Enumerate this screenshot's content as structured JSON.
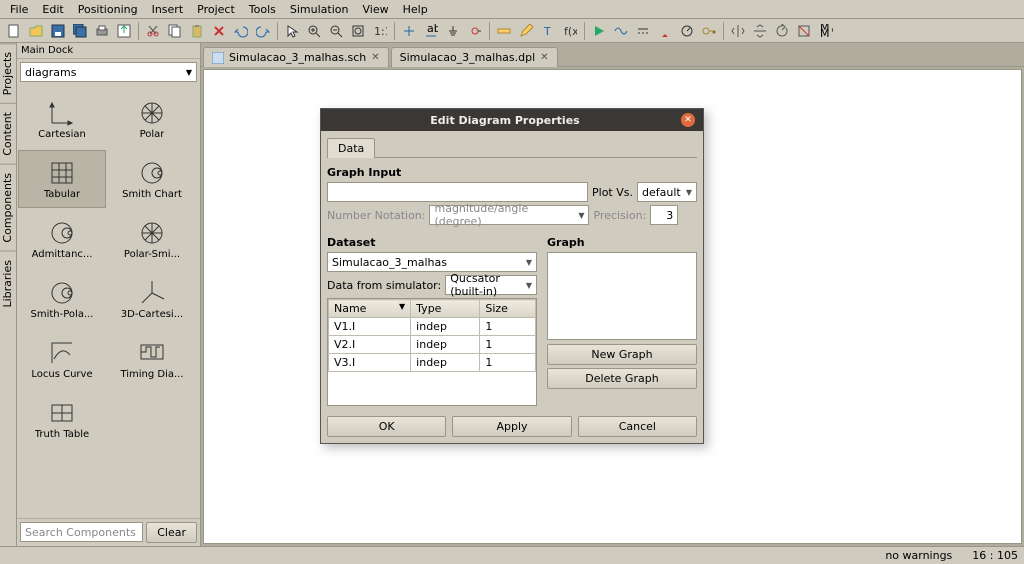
{
  "menu": [
    "File",
    "Edit",
    "Positioning",
    "Insert",
    "Project",
    "Tools",
    "Simulation",
    "View",
    "Help"
  ],
  "dock": {
    "title": "Main Dock",
    "combo": "diagrams",
    "items": [
      {
        "label": "Cartesian",
        "icon": "axes"
      },
      {
        "label": "Polar",
        "icon": "polar"
      },
      {
        "label": "Tabular",
        "icon": "tabular",
        "selected": true
      },
      {
        "label": "Smith Chart",
        "icon": "smith"
      },
      {
        "label": "Admittanc...",
        "icon": "smith"
      },
      {
        "label": "Polar-Smi...",
        "icon": "polar"
      },
      {
        "label": "Smith-Pola...",
        "icon": "smith"
      },
      {
        "label": "3D-Cartesi...",
        "icon": "3d"
      },
      {
        "label": "Locus Curve",
        "icon": "locus"
      },
      {
        "label": "Timing Dia...",
        "icon": "timing"
      },
      {
        "label": "Truth Table",
        "icon": "table"
      }
    ],
    "search_placeholder": "Search Components",
    "clear": "Clear"
  },
  "sidetabs": [
    "Projects",
    "Content",
    "Components",
    "Libraries"
  ],
  "docs": [
    {
      "label": "Simulacao_3_malhas.sch"
    },
    {
      "label": "Simulacao_3_malhas.dpl"
    }
  ],
  "status": {
    "warnings": "no warnings",
    "pos": "16 : 105"
  },
  "dialog": {
    "title": "Edit Diagram Properties",
    "tab": "Data",
    "graph_input_label": "Graph Input",
    "plot_vs": "Plot Vs.",
    "plot_vs_value": "default",
    "nn_label": "Number Notation:",
    "nn_value": "magnitude/angle (degree)",
    "precision_label": "Precision:",
    "precision_value": "3",
    "dataset_label": "Dataset",
    "dataset_value": "Simulacao_3_malhas",
    "dfs_label": "Data from simulator:",
    "dfs_value": "Qucsator (built-in)",
    "cols": [
      "Name",
      "Type",
      "Size"
    ],
    "rows": [
      {
        "name": "V1.I",
        "type": "indep",
        "size": "1"
      },
      {
        "name": "V2.I",
        "type": "indep",
        "size": "1"
      },
      {
        "name": "V3.I",
        "type": "indep",
        "size": "1"
      }
    ],
    "graph_label": "Graph",
    "new_graph": "New Graph",
    "delete_graph": "Delete Graph",
    "ok": "OK",
    "apply": "Apply",
    "cancel": "Cancel"
  }
}
